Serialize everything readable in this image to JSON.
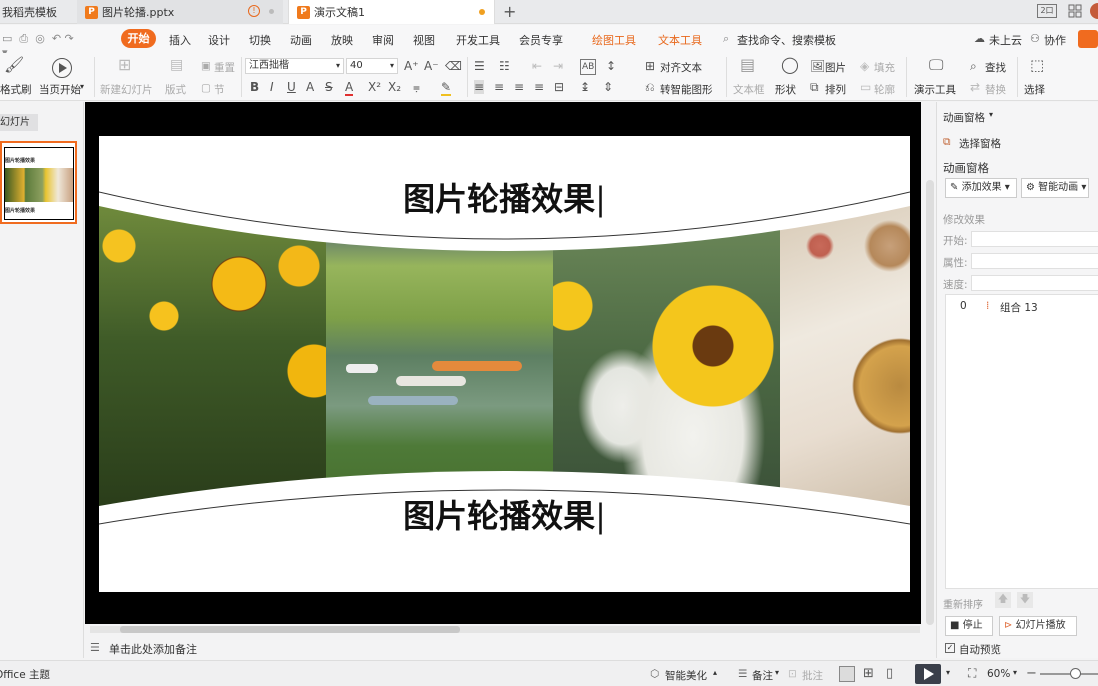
{
  "tabs": [
    {
      "label": "我稻壳模板"
    },
    {
      "label": "图片轮播.pptx"
    },
    {
      "label": "演示文稿1"
    }
  ],
  "window": {
    "layout_label": "2口"
  },
  "menu": {
    "start": "开始",
    "items": [
      "插入",
      "设计",
      "切换",
      "动画",
      "放映",
      "审阅",
      "视图",
      "开发工具",
      "会员专享"
    ],
    "tool_items": [
      "绘图工具",
      "文本工具"
    ],
    "search": "查找命令、搜索模板",
    "cloud": "未上云",
    "collab": "协作"
  },
  "ribbon": {
    "format_brush": "格式刷",
    "play_from_current": "当页开始",
    "new_slide": "新建幻灯片",
    "layout": "版式",
    "reset": "重置",
    "section": "节",
    "font_name": "江西拙楷",
    "font_size": "40",
    "align_text": "对齐文本",
    "smart_art": "转智能图形",
    "textbox": "文本框",
    "shape": "形状",
    "picture": "图片",
    "fill": "填充",
    "arrange": "排列",
    "outline": "轮廓",
    "show_tools": "演示工具",
    "find": "查找",
    "replace": "替换",
    "select": "选择"
  },
  "leftpane": {
    "header": "幻灯片",
    "thumb_title": "图片轮播效果"
  },
  "slide": {
    "title_top": "图片轮播效果",
    "title_bottom": "图片轮播效果"
  },
  "rightpane": {
    "pane_label": "动画窗格",
    "select_pane": "选择窗格",
    "anim_pane": "动画窗格",
    "add_effect": "添加效果",
    "smart_anim": "智能动画",
    "modify_effect": "修改效果",
    "start_label": "开始:",
    "property_label": "属性:",
    "speed_label": "速度:",
    "list_index": "0",
    "list_item": "组合 13",
    "reorder": "重新排序",
    "stop": "停止",
    "slideshow": "幻灯片播放",
    "auto_preview": "自动预览"
  },
  "notes": {
    "placeholder": "单击此处添加备注"
  },
  "status": {
    "theme": "Office 主题",
    "beautify": "智能美化",
    "notes": "备注",
    "comment": "批注",
    "zoom": "60%"
  },
  "colors": {
    "accent": "#f06b1f",
    "tool_tab": "#e8681c"
  }
}
